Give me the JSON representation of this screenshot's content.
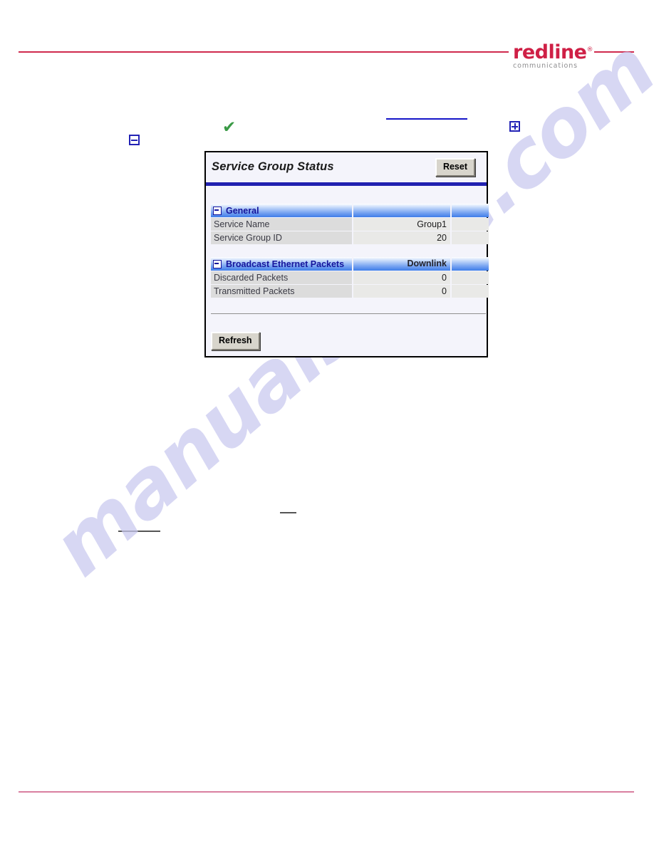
{
  "brand": {
    "name": "redline",
    "trademark": "®",
    "tagline": "communications"
  },
  "stray_marks": {
    "collapse_icon": "minus-box",
    "expand_icon": "plus-box",
    "check_icon": "✔"
  },
  "watermark": {
    "text": "manualshive.com"
  },
  "panel": {
    "title": "Service Group Status",
    "reset_label": "Reset",
    "refresh_label": "Refresh",
    "groups": [
      {
        "name": "General",
        "toggle": "collapse-icon",
        "col2_header": "",
        "col3_header": "",
        "rows": [
          {
            "label": "Service Name",
            "value": "Group1",
            "value2": ""
          },
          {
            "label": "Service Group ID",
            "value": "20",
            "value2": ""
          }
        ]
      },
      {
        "name": "Broadcast Ethernet Packets",
        "toggle": "collapse-icon",
        "col2_header": "Downlink",
        "col3_header": "",
        "rows": [
          {
            "label": "Discarded Packets",
            "value": "0",
            "value2": ""
          },
          {
            "label": "Transmitted Packets",
            "value": "0",
            "value2": ""
          }
        ]
      }
    ]
  },
  "colors": {
    "brand_red": "#cf2046",
    "rule_top": "#cf2a4e",
    "rule_bottom": "#d97fa0",
    "panel_accent_blue": "#2121b0",
    "header_text_blue": "#15159c",
    "check_green": "#3a9a46",
    "icon_blue": "#2222b5",
    "watermark": "#c9c9ef"
  }
}
